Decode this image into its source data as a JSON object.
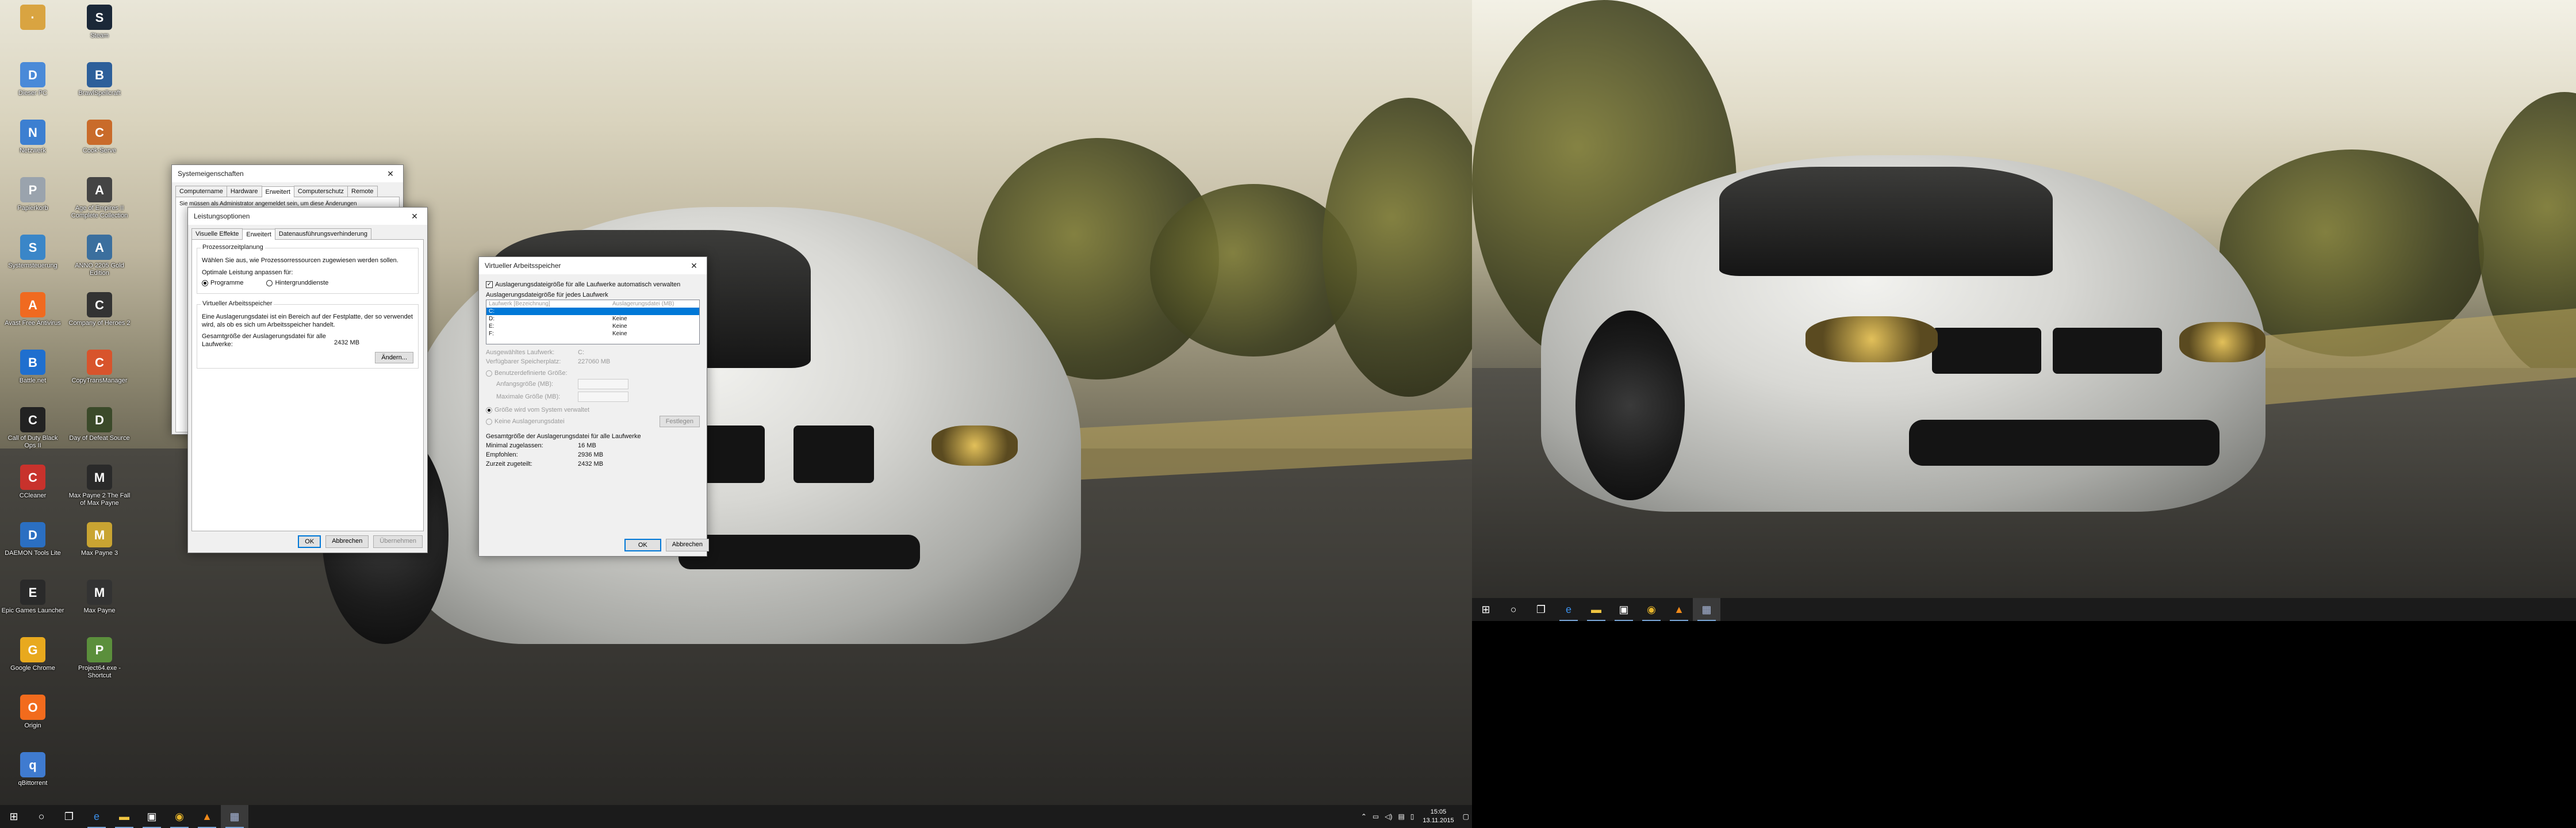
{
  "desktop": {
    "icons_col1": [
      {
        "label": "",
        "icon": "user-folder-icon",
        "color": "#d9a441"
      },
      {
        "label": "Dieser PC",
        "icon": "computer-icon",
        "color": "#4a8ad8"
      },
      {
        "label": "Netzwerk",
        "icon": "network-icon",
        "color": "#3c7fd1"
      },
      {
        "label": "Papierkorb",
        "icon": "recycle-bin-icon",
        "color": "#9aa3ad"
      },
      {
        "label": "Systemsteuerung",
        "icon": "control-panel-icon",
        "color": "#3a86c8"
      },
      {
        "label": "Avast Free Antivirus",
        "icon": "avast-icon",
        "color": "#f06a20"
      },
      {
        "label": "Battle.net",
        "icon": "battlenet-icon",
        "color": "#1f6fcf"
      },
      {
        "label": "Call of Duty Black Ops II",
        "icon": "cod-icon",
        "color": "#222222"
      },
      {
        "label": "CCleaner",
        "icon": "ccleaner-icon",
        "color": "#c8322c"
      },
      {
        "label": "DAEMON Tools Lite",
        "icon": "daemon-tools-icon",
        "color": "#2b6fc2"
      },
      {
        "label": "Epic Games Launcher",
        "icon": "epic-games-icon",
        "color": "#2a2a2a"
      },
      {
        "label": "Google Chrome",
        "icon": "chrome-icon",
        "color": "#e8a91e"
      },
      {
        "label": "Origin",
        "icon": "origin-icon",
        "color": "#f26b1d"
      },
      {
        "label": "qBittorrent",
        "icon": "qbittorrent-icon",
        "color": "#3f7bd0"
      }
    ],
    "icons_col2": [
      {
        "label": "Steam",
        "icon": "steam-icon",
        "color": "#1b2838"
      },
      {
        "label": "BrawlSpellcraft",
        "icon": "game-icon",
        "color": "#2d5f9a"
      },
      {
        "label": "Cook-Serve",
        "icon": "game-icon",
        "color": "#c96b2a"
      },
      {
        "label": "Age of Empires II Complete Collection",
        "icon": "aoe-icon",
        "color": "#444444"
      },
      {
        "label": "ANNO 2205 Gold Edition",
        "icon": "anno-icon",
        "color": "#3b6f9e"
      },
      {
        "label": "Company of Heroes 2",
        "icon": "coh-icon",
        "color": "#333333"
      },
      {
        "label": "CopyTransManager",
        "icon": "copytrans-icon",
        "color": "#d8542c"
      },
      {
        "label": "Day of Defeat Source",
        "icon": "dod-icon",
        "color": "#3b4a2a"
      },
      {
        "label": "Max Payne 2 The Fall of Max Payne",
        "icon": "maxpayne-icon",
        "color": "#2a2a2a"
      },
      {
        "label": "Max Payne 3",
        "icon": "maxpayne3-icon",
        "color": "#c9a432"
      },
      {
        "label": "Max Payne",
        "icon": "maxpayne-icon",
        "color": "#333333"
      },
      {
        "label": "Project64.exe - Shortcut",
        "icon": "project64-icon",
        "color": "#5b8f3c"
      }
    ]
  },
  "taskbar_left": {
    "start": "⊞",
    "search": "○",
    "taskview": "❐",
    "items": [
      {
        "name": "edge",
        "glyph": "e",
        "color": "#3b8ee8"
      },
      {
        "name": "explorer",
        "glyph": "▬",
        "color": "#f0c541"
      },
      {
        "name": "store",
        "glyph": "▣",
        "color": "#ffffff"
      },
      {
        "name": "chrome",
        "glyph": "◉",
        "color": "#e6b42b"
      },
      {
        "name": "vlc",
        "glyph": "▲",
        "color": "#f08a1a"
      },
      {
        "name": "system",
        "glyph": "▦",
        "color": "#a7b6d8"
      }
    ],
    "clock_time": "15:05",
    "clock_date": "13.11.2015"
  },
  "taskbar_right": {
    "start": "⊞",
    "search": "○",
    "taskview": "❐",
    "items": [
      {
        "name": "edge",
        "glyph": "e",
        "color": "#3b8ee8"
      },
      {
        "name": "explorer",
        "glyph": "▬",
        "color": "#f0c541"
      },
      {
        "name": "store",
        "glyph": "▣",
        "color": "#ffffff"
      },
      {
        "name": "chrome",
        "glyph": "◉",
        "color": "#e6b42b"
      },
      {
        "name": "vlc",
        "glyph": "▲",
        "color": "#f08a1a"
      },
      {
        "name": "system",
        "glyph": "▦",
        "color": "#a7b6d8"
      }
    ]
  },
  "sysprops": {
    "title": "Systemeigenschaften",
    "tabs": [
      "Computername",
      "Hardware",
      "Erweitert",
      "Computerschutz",
      "Remote"
    ],
    "selected_tab": "Erweitert",
    "notice": "Sie müssen als Administrator angemeldet sein, um diese Änderungen"
  },
  "perf": {
    "title": "Leistungsoptionen",
    "tabs": [
      "Visuelle Effekte",
      "Erweitert",
      "Datenausführungsverhinderung"
    ],
    "selected_tab": "Erweitert",
    "proc_group": "Prozessorzeitplanung",
    "proc_text": "Wählen Sie aus, wie Prozessorressourcen zugewiesen werden sollen.",
    "proc_label": "Optimale Leistung anpassen für:",
    "opt_programs": "Programme",
    "opt_background": "Hintergrunddienste",
    "vm_group": "Virtueller Arbeitsspeicher",
    "vm_text": "Eine Auslagerungsdatei ist ein Bereich auf der Festplatte, der so verwendet wird, als ob es sich um Arbeitsspeicher handelt.",
    "vm_total_label": "Gesamtgröße der Auslagerungsdatei für alle Laufwerke:",
    "vm_total_value": "2432 MB",
    "change_btn": "Ändern...",
    "ok": "OK",
    "cancel": "Abbrechen",
    "apply": "Übernehmen"
  },
  "vm": {
    "title": "Virtueller Arbeitsspeicher",
    "auto_label": "Auslagerungsdateigröße für alle Laufwerke automatisch verwalten",
    "per_drive": "Auslagerungsdateigröße für jedes Laufwerk",
    "col_drive": "Laufwerk [Bezeichnung]",
    "col_size": "Auslagerungsdatei (MB)",
    "drives": [
      {
        "drive": "C:",
        "size": ""
      },
      {
        "drive": "D:",
        "size": "Keine"
      },
      {
        "drive": "E:",
        "size": "Keine"
      },
      {
        "drive": "F:",
        "size": "Keine"
      }
    ],
    "selected_drive_label": "Ausgewähltes Laufwerk:",
    "selected_drive_value": "C:",
    "free_space_label": "Verfügbarer Speicherplatz:",
    "free_space_value": "227060 MB",
    "custom_size": "Benutzerdefinierte Größe:",
    "initial_size": "Anfangsgröße (MB):",
    "max_size": "Maximale Größe (MB):",
    "system_managed": "Größe wird vom System verwaltet",
    "no_paging": "Keine Auslagerungsdatei",
    "set_btn": "Festlegen",
    "total_group": "Gesamtgröße der Auslagerungsdatei für alle Laufwerke",
    "min_label": "Minimal zugelassen:",
    "min_value": "16 MB",
    "rec_label": "Empfohlen:",
    "rec_value": "2936 MB",
    "cur_label": "Zurzeit zugeteilt:",
    "cur_value": "2432 MB",
    "ok": "OK",
    "cancel": "Abbrechen"
  }
}
